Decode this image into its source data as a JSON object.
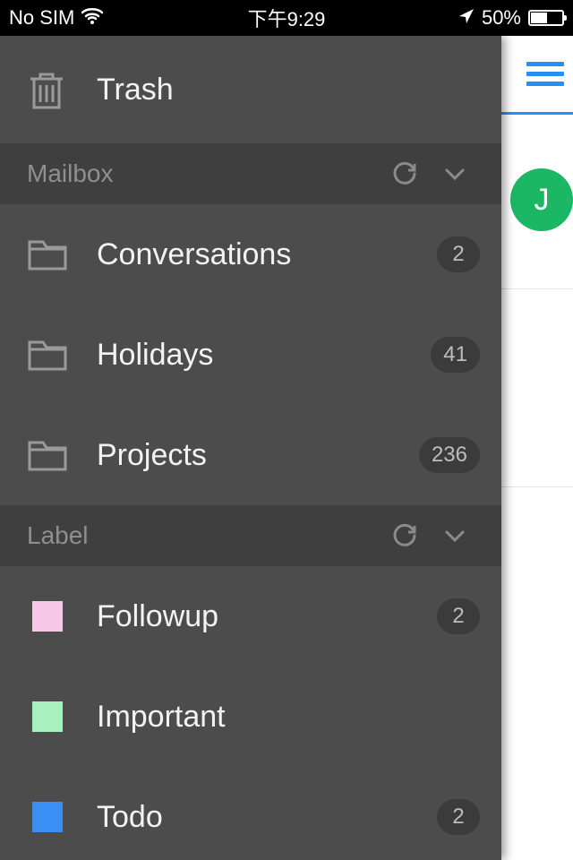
{
  "status": {
    "carrier": "No SIM",
    "time": "下午9:29",
    "battery_pct": "50%"
  },
  "main": {
    "avatar_initial": "J"
  },
  "drawer": {
    "trash_label": "Trash",
    "sections": {
      "mailbox": {
        "title": "Mailbox",
        "items": [
          {
            "label": "Conversations",
            "count": "2"
          },
          {
            "label": "Holidays",
            "count": "41"
          },
          {
            "label": "Projects",
            "count": "236"
          }
        ]
      },
      "label": {
        "title": "Label",
        "items": [
          {
            "label": "Followup",
            "color": "#f6c8e8",
            "count": "2"
          },
          {
            "label": "Important",
            "color": "#a9f0bf",
            "count": ""
          },
          {
            "label": "Todo",
            "color": "#3b8ef3",
            "count": "2"
          }
        ]
      }
    }
  }
}
